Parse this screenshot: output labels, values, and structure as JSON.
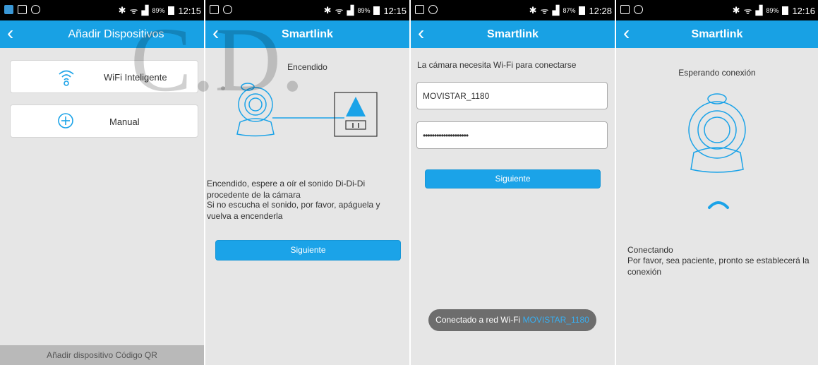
{
  "watermark": "C.D.",
  "status_bars": [
    {
      "signal": "89%",
      "time": "12:15"
    },
    {
      "signal": "89%",
      "time": "12:15"
    },
    {
      "signal": "87%",
      "time": "12:28"
    },
    {
      "signal": "89%",
      "time": "12:16"
    }
  ],
  "screen1": {
    "title": "Añadir Dispositivos",
    "option_wifi": "WiFi Inteligente",
    "option_manual": "Manual",
    "bottom_qr": "Añadir dispositivo Código QR"
  },
  "screen2": {
    "title": "Smartlink",
    "heading": "Encendido",
    "instructions_line1": "Encendido, espere a oír el sonido Di-Di-Di procedente de la cámara",
    "instructions_line2": "Si no escucha el sonido, por favor, apáguela y vuelva a encenderla",
    "next_button": "Siguiente"
  },
  "screen3": {
    "title": "Smartlink",
    "prompt": "La cámara necesita Wi-Fi para conectarse",
    "ssid_value": "MOVISTAR_1180",
    "password_value": "••••••••••••••••••••",
    "next_button": "Siguiente",
    "toast_prefix": "Conectado a red Wi-Fi ",
    "toast_network": "MOVISTAR_1180"
  },
  "screen4": {
    "title": "Smartlink",
    "heading": "Esperando conexión",
    "status_title": "Conectando",
    "status_text": "Por favor, sea paciente, pronto se establecerá la conexión"
  },
  "colors": {
    "titlebar": "#18a1e4",
    "button": "#1ba3e8",
    "background": "#e6e6e6",
    "toast": "#6d6d6d"
  },
  "icons": [
    "back-arrow-icon",
    "wifi-smart-icon",
    "add-manual-icon",
    "camera-icon",
    "power-outlet-icon",
    "loading-spinner-icon",
    "bluetooth-icon",
    "wifi-signal-icon",
    "battery-icon"
  ]
}
